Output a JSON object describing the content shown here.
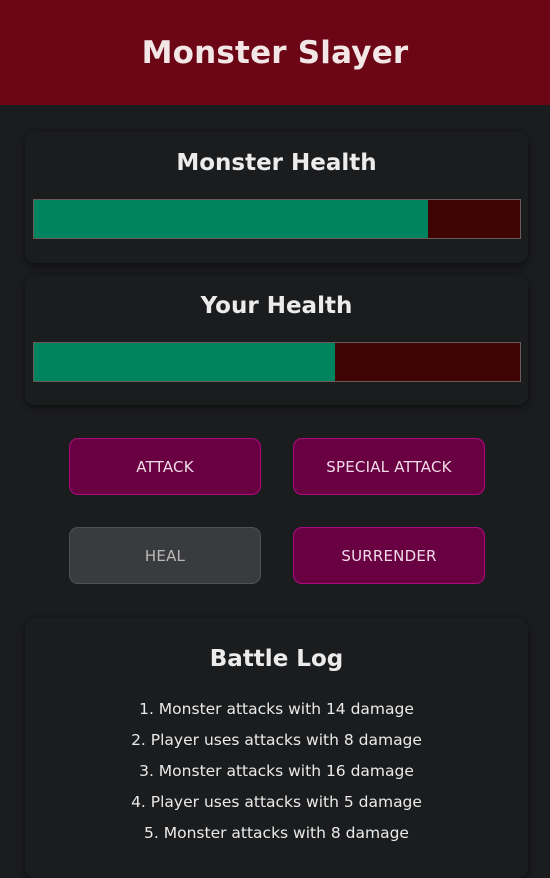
{
  "header": {
    "title": "Monster Slayer"
  },
  "monster": {
    "title": "Monster Health",
    "health_percent": 81
  },
  "player": {
    "title": "Your Health",
    "health_percent": 62
  },
  "controls": {
    "attack": "ATTACK",
    "special_attack": "SPECIAL ATTACK",
    "heal": "HEAL",
    "surrender": "SURRENDER"
  },
  "log": {
    "title": "Battle Log",
    "entries": [
      "1. Monster attacks with 14 damage",
      "2. Player uses attacks with 8 damage",
      "3. Monster attacks with 16 damage",
      "4. Player uses attacks with 5 damage",
      "5. Monster attacks with 8 damage"
    ]
  },
  "colors": {
    "header_bg": "#6c0515",
    "health_fill": "#00845f",
    "health_empty": "#410404",
    "button_bg": "#690042",
    "button_border": "#ae0a80",
    "button_disabled_bg": "#3a3b3d"
  }
}
